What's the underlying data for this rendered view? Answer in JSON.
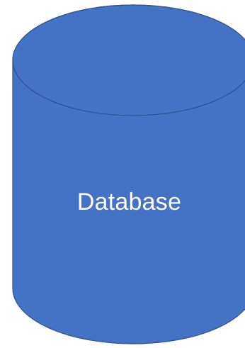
{
  "shape": {
    "type": "cylinder",
    "label": "Database",
    "fill_color": "#4472C4",
    "stroke_color": "#2F528F",
    "text_color": "#FFFFFF"
  }
}
